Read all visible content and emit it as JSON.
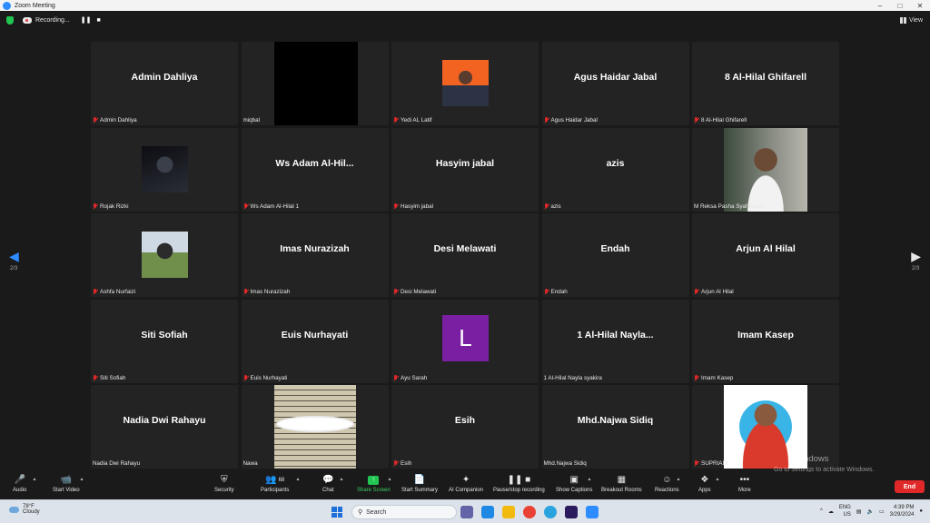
{
  "window": {
    "title": "Zoom Meeting"
  },
  "topbar": {
    "recording_label": "Recording...",
    "pause_icon": "pause-icon",
    "stop_icon": "stop-icon",
    "view_label": "View"
  },
  "participants": [
    {
      "display": "Admin Dahliya",
      "label": "Admin Dahliya",
      "muted": true
    },
    {
      "display": "",
      "label": "miqbal",
      "muted": false,
      "video": "black"
    },
    {
      "display": "",
      "label": "Yedi AL Latif",
      "muted": true,
      "video": "photo-orange"
    },
    {
      "display": "Agus Haidar Jabal",
      "label": "Agus Haidar Jabal",
      "muted": true
    },
    {
      "display": "8 Al-Hilal Ghifarell",
      "label": "8 Al-Hilal Ghifarell",
      "muted": true
    },
    {
      "display": "",
      "label": "Rojak Rizki",
      "muted": true,
      "video": "photo-dark"
    },
    {
      "display": "Ws Adam Al-Hil...",
      "label": "Ws Adam Al-Hilal 1",
      "muted": true
    },
    {
      "display": "Hasyim jabal",
      "label": "Hasyim jabal",
      "muted": true
    },
    {
      "display": "azis",
      "label": "azis",
      "muted": true
    },
    {
      "display": "",
      "label": "M Reksa Pasha Syahbasan",
      "muted": false,
      "video": "live-camera"
    },
    {
      "display": "",
      "label": "Ashfa Nurfaizi",
      "muted": true,
      "video": "photo-outdoor"
    },
    {
      "display": "Imas Nurazizah",
      "label": "Imas Nurazizah",
      "muted": true
    },
    {
      "display": "Desi Melawati",
      "label": "Desi Melawati",
      "muted": true
    },
    {
      "display": "Endah",
      "label": "Endah",
      "muted": true
    },
    {
      "display": "Arjun Al Hilal",
      "label": "Arjun Al Hilal",
      "muted": true
    },
    {
      "display": "Siti Sofiah",
      "label": "Siti Sofiah",
      "muted": true
    },
    {
      "display": "Euis Nurhayati",
      "label": "Euis Nurhayati",
      "muted": true
    },
    {
      "display": "",
      "label": "Ayu Sarah",
      "muted": true,
      "avatar_letter": "L"
    },
    {
      "display": "1  Al-Hilal  Nayla...",
      "label": "1 Al-Hilal Nayla syakira",
      "muted": false
    },
    {
      "display": "Imam Kasep",
      "label": "Imam Kasep",
      "muted": true
    },
    {
      "display": "Nadia Dwi Rahayu",
      "label": "Nadia Dwi Rahayu",
      "muted": false
    },
    {
      "display": "",
      "label": "Nawa",
      "muted": false,
      "video": "quran-text"
    },
    {
      "display": "Esih",
      "label": "Esih",
      "muted": true
    },
    {
      "display": "Mhd.Najwa Sidiq",
      "label": "Mhd.Najwa Sidiq",
      "muted": false
    },
    {
      "display": "",
      "label": "SUPRIADI",
      "muted": true,
      "video": "photo-red"
    }
  ],
  "pagination": {
    "left": "2/3",
    "right": "2/3"
  },
  "toolbar": {
    "audio": "Audio",
    "start_video": "Start Video",
    "security": "Security",
    "participants": "Participants",
    "participants_count": "68",
    "chat": "Chat",
    "share_screen": "Share Screen",
    "start_summary": "Start Summary",
    "ai_companion": "AI Companion",
    "pause_recording": "Pause/stop recording",
    "show_captions": "Show Captions",
    "breakout_rooms": "Breakout Rooms",
    "reactions": "Reactions",
    "apps": "Apps",
    "more": "More",
    "end": "End"
  },
  "watermark": {
    "title": "Windows",
    "subtitle": "Go to Settings to activate Windows."
  },
  "taskbar": {
    "weather_temp": "78°F",
    "weather_desc": "Cloudy",
    "search_placeholder": "Search",
    "lang": "ENG",
    "region": "US",
    "time": "4:39 PM",
    "date": "3/29/2024"
  },
  "colors": {
    "accent": "#2d8cff",
    "share_green": "#23c552",
    "end_red": "#e02828",
    "avatar_purple": "#7b1fa2"
  }
}
